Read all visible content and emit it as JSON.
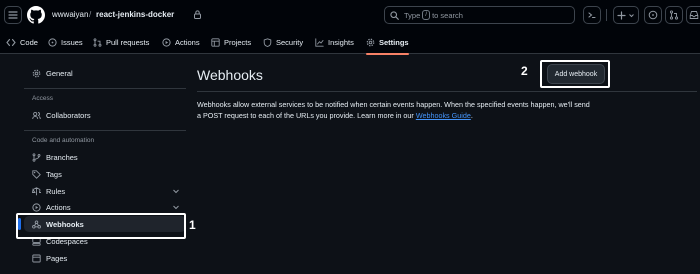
{
  "header": {
    "owner": "wwwaiyan",
    "separator": "/",
    "repo": "react-jenkins-docker",
    "search_prefix": "Type",
    "search_key": "/",
    "search_suffix": "to search"
  },
  "tabs": [
    {
      "label": "Code",
      "icon": "code-icon"
    },
    {
      "label": "Issues",
      "icon": "issue-icon"
    },
    {
      "label": "Pull requests",
      "icon": "pull-request-icon"
    },
    {
      "label": "Actions",
      "icon": "play-icon"
    },
    {
      "label": "Projects",
      "icon": "table-icon"
    },
    {
      "label": "Security",
      "icon": "shield-icon"
    },
    {
      "label": "Insights",
      "icon": "graph-icon"
    },
    {
      "label": "Settings",
      "icon": "gear-icon",
      "selected": true
    }
  ],
  "sidebar": {
    "general": "General",
    "access_heading": "Access",
    "collaborators": "Collaborators",
    "code_heading": "Code and automation",
    "branches": "Branches",
    "tags": "Tags",
    "rules": "Rules",
    "actions": "Actions",
    "webhooks": "Webhooks",
    "codespaces": "Codespaces",
    "pages": "Pages"
  },
  "main": {
    "title": "Webhooks",
    "add_button": "Add webhook",
    "description_line1": "Webhooks allow external services to be notified when certain events happen. When the specified events happen, we'll send",
    "description_line2": "a POST request to each of the URLs you provide. Learn more in our",
    "guide_link": "Webhooks Guide",
    "description_end": "."
  },
  "annotations": {
    "marker_1": "1",
    "marker_2": "2"
  },
  "colors": {
    "background": "#0d1117",
    "header": "#010409",
    "accent": "#f78166",
    "link": "#4493f8",
    "selected_indicator": "#1f6feb",
    "highlight_box": "#ffffff"
  }
}
